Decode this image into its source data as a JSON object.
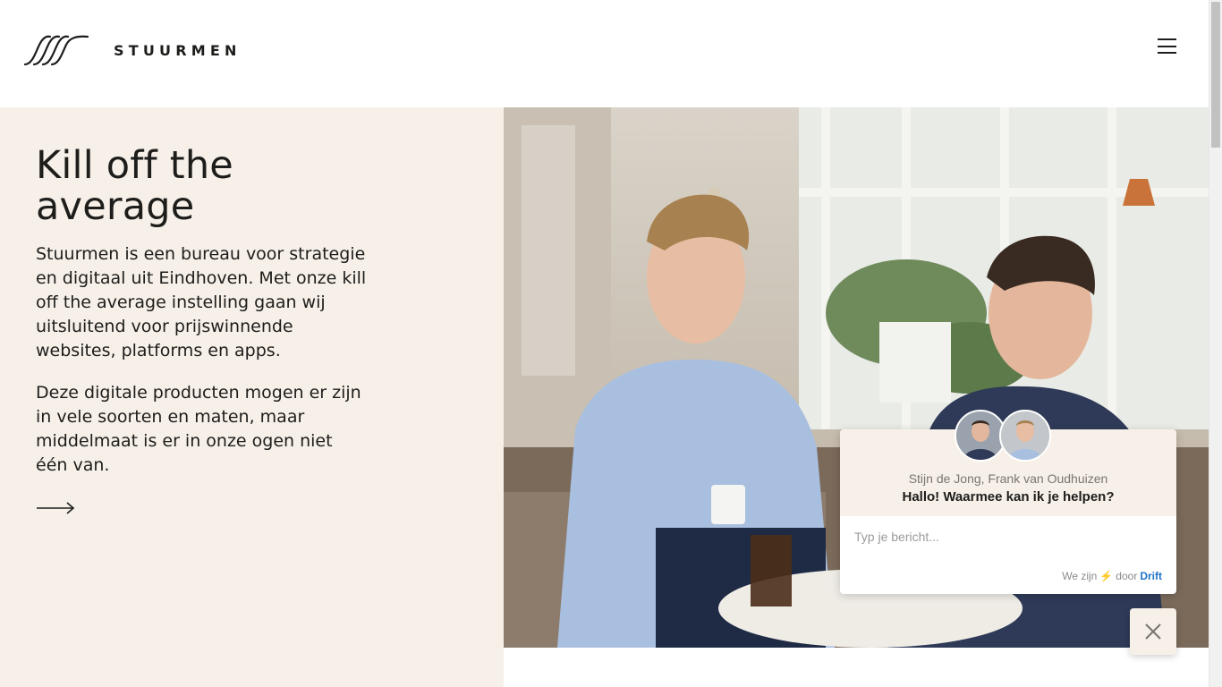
{
  "header": {
    "brand": "STUURMEN",
    "menu_icon": "hamburger-icon"
  },
  "hero": {
    "title": "Kill off the average",
    "paragraph1": "Stuurmen is een bureau voor strategie en digitaal uit Eindhoven. Met onze kill off the average instelling gaan wij uitsluitend voor prijswinnende websites, platforms en apps.",
    "paragraph2": "Deze digitale producten mogen er zijn in vele soorten en maten, maar middelmaat is er in onze ogen niet één van.",
    "arrow_icon": "arrow-right-icon"
  },
  "chat": {
    "agents": "Stijn de Jong, Frank van Oudhuizen",
    "greeting": "Hallo! Waarmee kan ik je helpen?",
    "input_placeholder": "Typ je bericht...",
    "footer_prefix": "We zijn",
    "footer_mid": "door",
    "footer_brand": "Drift",
    "close_icon": "close-icon"
  },
  "colors": {
    "cream": "#f7f0e8",
    "text": "#1d1d1b",
    "drift_blue": "#1f73c9",
    "bolt": "#f5a623"
  }
}
